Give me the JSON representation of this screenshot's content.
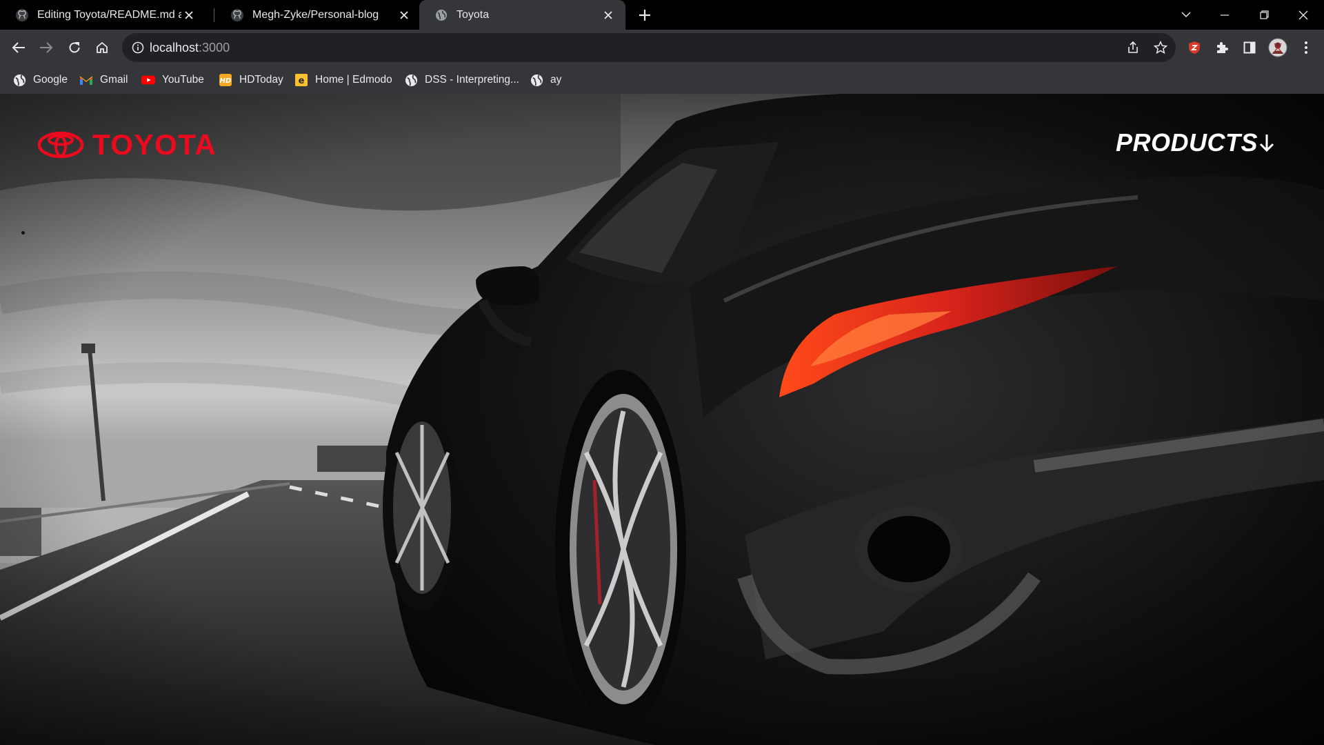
{
  "tabs": [
    {
      "title": "Editing Toyota/README.md at m",
      "icon": "github-icon",
      "active": false
    },
    {
      "title": "Megh-Zyke/Personal-blog",
      "icon": "github-icon",
      "active": false
    },
    {
      "title": "Toyota",
      "icon": "globe-icon",
      "active": true
    }
  ],
  "address_bar": {
    "host": "localhost",
    "port": ":3000"
  },
  "bookmarks": [
    {
      "label": "Google",
      "icon": "globe-icon"
    },
    {
      "label": "Gmail",
      "icon": "gmail-icon"
    },
    {
      "label": "YouTube",
      "icon": "youtube-icon"
    },
    {
      "label": "HDToday",
      "icon": "hdtoday-icon"
    },
    {
      "label": "Home | Edmodo",
      "icon": "edmodo-icon"
    },
    {
      "label": "DSS - Interpreting...",
      "icon": "globe-icon"
    },
    {
      "label": "ay",
      "icon": "globe-icon"
    }
  ],
  "page": {
    "logo_text": "TOYOTA",
    "nav_products": "PRODUCTS",
    "brand_color": "#eb0a1e",
    "hero_image": "black sports car rear three-quarter view on road under cloudy sky"
  },
  "colors": {
    "tab_bar": "#000000",
    "toolbar": "#35363a",
    "omnibox": "#202124"
  }
}
